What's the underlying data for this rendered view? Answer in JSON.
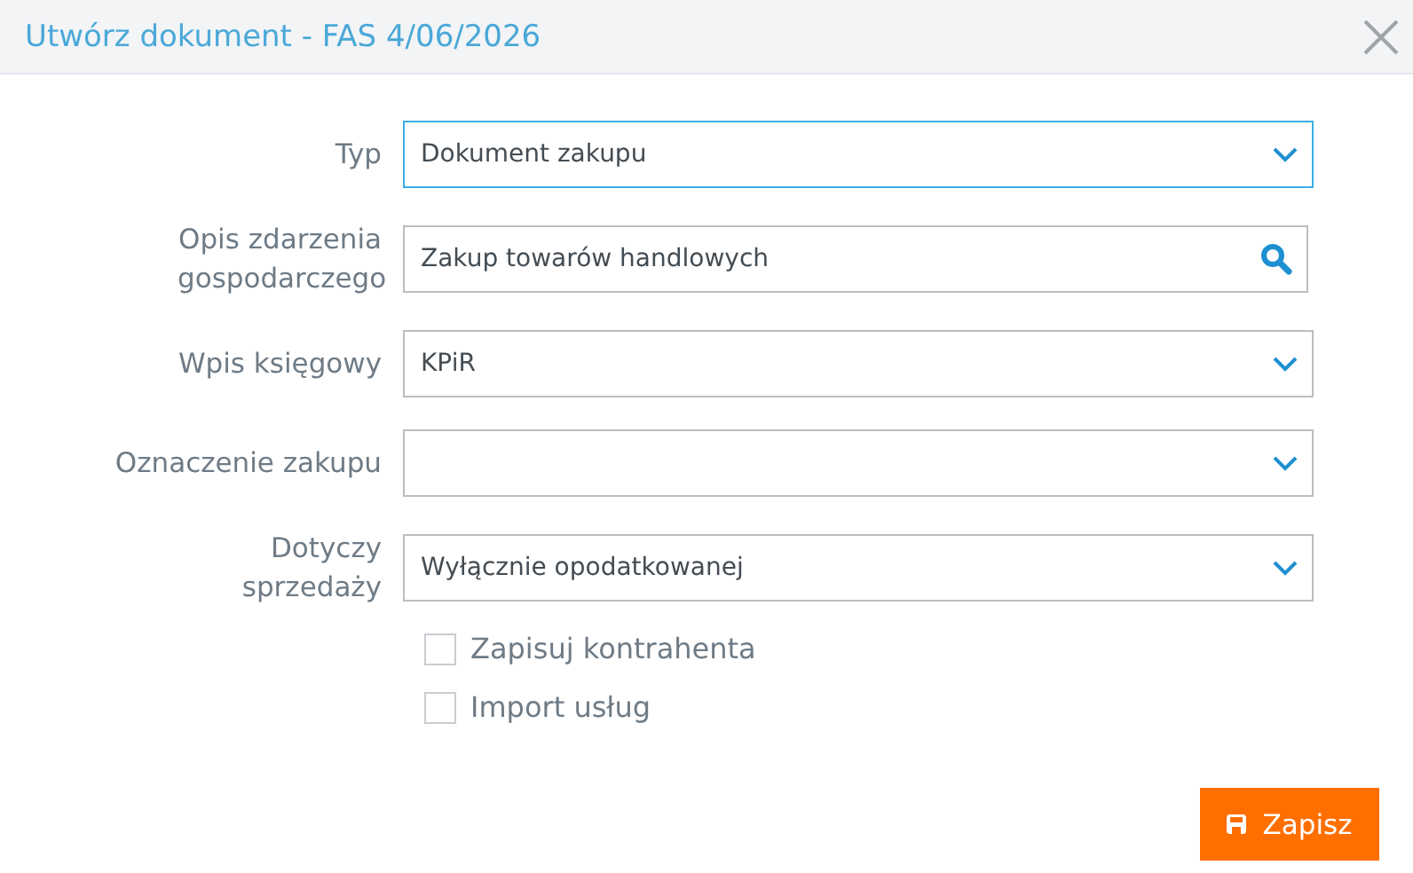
{
  "window": {
    "title": "Utwórz dokument - FAS 4/06/2026"
  },
  "fields": [
    {
      "label": "Typ",
      "kind": "select",
      "value": "Dokument zakupu",
      "focused": true
    },
    {
      "label": "Opis zdarzenia gospodarczego",
      "kind": "search",
      "value": "Zakup towarów handlowych",
      "focused": false
    },
    {
      "label": "Wpis księgowy",
      "kind": "select",
      "value": "KPiR",
      "focused": false
    },
    {
      "label": "Oznaczenie zakupu",
      "kind": "select",
      "focused": false
    },
    {
      "label": "Dotyczy sprzedaży",
      "kind": "select",
      "value": "Wyłącznie opodatkowanej",
      "focused": false
    }
  ],
  "checkboxes": [
    {
      "label": "Zapisuj kontrahenta",
      "checked": false
    },
    {
      "label": "Import usług",
      "checked": false
    }
  ],
  "buttons": [
    {
      "label": "Zapisz"
    }
  ]
}
